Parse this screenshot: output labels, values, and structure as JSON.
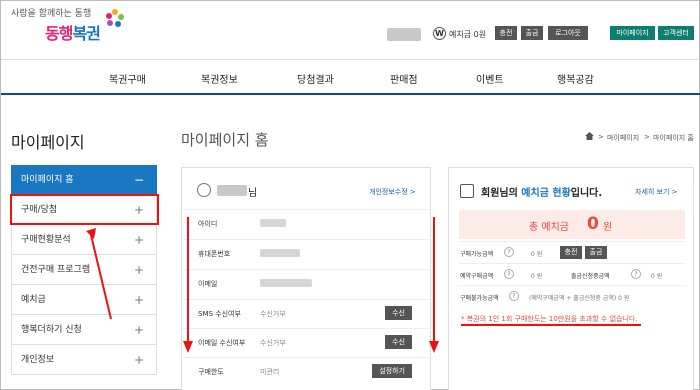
{
  "header": {
    "tagline": "사랑을 함께하는 동행",
    "logo_a": "동행",
    "logo_b": "복권",
    "deposit_label": "예치금 0원",
    "buttons": [
      "충전",
      "출금",
      "로그아웃"
    ],
    "teal_buttons": [
      "마이페이지",
      "고객센터"
    ]
  },
  "nav": [
    "복권구매",
    "복권정보",
    "당첨결과",
    "판매점",
    "이벤트",
    "행복공감"
  ],
  "sidebar": {
    "title": "마이페이지",
    "items": [
      {
        "label": "마이페이지 홈",
        "sign": "−"
      },
      {
        "label": "구매/당첨",
        "sign": "+"
      },
      {
        "label": "구매현황분석",
        "sign": "+"
      },
      {
        "label": "건전구매 프로그램",
        "sign": "+"
      },
      {
        "label": "예치금",
        "sign": "+"
      },
      {
        "label": "행복더하기 신청",
        "sign": "+"
      },
      {
        "label": "개인정보",
        "sign": "+"
      }
    ]
  },
  "main": {
    "title": "마이페이지 홈",
    "breadcrumb": [
      ">",
      "마이페이지",
      ">",
      "마이페이지 홈"
    ]
  },
  "profile": {
    "name_suffix": "님",
    "edit_link": "개인정보수정 >",
    "rows": [
      {
        "label": "아이디",
        "value": ""
      },
      {
        "label": "휴대폰번호",
        "value": ""
      },
      {
        "label": "이메일",
        "value": ""
      },
      {
        "label": "SMS 수신여부",
        "value": "수신거부",
        "button": "수신"
      },
      {
        "label": "이메일 수신여부",
        "value": "수신거부",
        "button": "수신"
      },
      {
        "label": "구매한도",
        "value": "미관리",
        "button": "설정하기"
      }
    ]
  },
  "deposit": {
    "title_a": "회원님의 ",
    "title_b": "예치금 현황",
    "title_c": "입니다.",
    "detail_link": "자세히 보기 >",
    "total_label": "총 예치금",
    "total_value": "0",
    "total_unit": "원",
    "rows": [
      {
        "label": "구매가능금액",
        "value": "0 원",
        "buttons": [
          "충전",
          "출금"
        ]
      },
      {
        "label": "예약구매금액",
        "value": "0 원",
        "label2": "출금신청중금액",
        "value2": "0 원"
      },
      {
        "label": "구매불가능금액",
        "value": "(예약구매금액 + 출금신청중 금액)  0 원"
      }
    ],
    "notice": "* 복권의 1인 1회 구매한도는 10만원을 초과할 수 없습니다."
  },
  "colors": {
    "accent": "#1a78c2",
    "teal": "#0e7e72",
    "highlight": "#e11111"
  }
}
